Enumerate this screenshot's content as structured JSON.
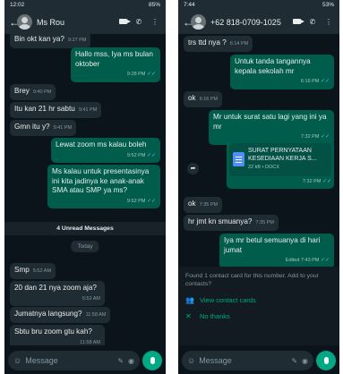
{
  "left": {
    "status": {
      "time": "12:02",
      "right": "85%"
    },
    "contact_name": "Ms Rou",
    "messages": [
      {
        "text": "Bin okt kan ya?",
        "time": "9:27 PM"
      },
      {
        "text": "Hallo mss, Iya ms bulan oktober",
        "time": "9:28 PM"
      },
      {
        "text": "Brey",
        "time": "9:40 PM"
      },
      {
        "text": "Itu kan 21 hr sabtu",
        "time": "9:41 PM"
      },
      {
        "text": "Gmn itu y?",
        "time": "9:41 PM"
      },
      {
        "text": "Lewat zoom ms kalau boleh",
        "time": "9:52 PM"
      },
      {
        "text": "Ms kalau untuk presentasinya ini kita jadinya ke anak-anak SMA atau SMP ya ms?",
        "time": "9:52 PM"
      },
      {
        "text": "Smp",
        "time": "5:52 AM"
      },
      {
        "text": "20 dan 21 nya zoom aja?",
        "time": "5:52 AM"
      },
      {
        "text": "Jumatnya langsung?",
        "time": "11:58 AM"
      },
      {
        "text": "Sbtu bru zoom gtu kah?",
        "time": "11:58 AM"
      }
    ],
    "unread": "4 Unread Messages",
    "day": "Today",
    "placeholder": "Message"
  },
  "right": {
    "status": {
      "time": "7:44",
      "right": "53%"
    },
    "contact_name": "+62 818-0709-1025",
    "messages": [
      {
        "text": "trs ttd nya ?",
        "time": "6:14 PM"
      },
      {
        "text": "Untuk tanda tangannya kepala sekolah mr",
        "time": "6:16 PM"
      },
      {
        "text": "ok",
        "time": "6:16 PM"
      },
      {
        "text": "Mr untuk surat satu lagi yang ini ya mr",
        "time": "7:32 PM"
      },
      {
        "text": "ok",
        "time": "7:35 PM"
      },
      {
        "text": "hr jmt kn smuanya?",
        "time": "7:35 PM"
      },
      {
        "text": "Iya mr betul semuanya di hari jumat",
        "time": "Edited 7:43 PM"
      }
    ],
    "document": {
      "title": "SURAT PERNYATAAN KESEDIAAN KERJA S...",
      "meta": "22 kB • DOCX",
      "time": "7:32 PM"
    },
    "contact_card": {
      "text": "Found 1 contact card for this number. Add to your contacts?",
      "view": "View contact cards",
      "dismiss": "No thanks"
    },
    "placeholder": "Message"
  },
  "colors": {
    "bg": "#0b141a",
    "incoming": "#202c33",
    "outgoing": "#005c4b",
    "accent": "#00a884",
    "read_tick": "#53bdeb"
  }
}
